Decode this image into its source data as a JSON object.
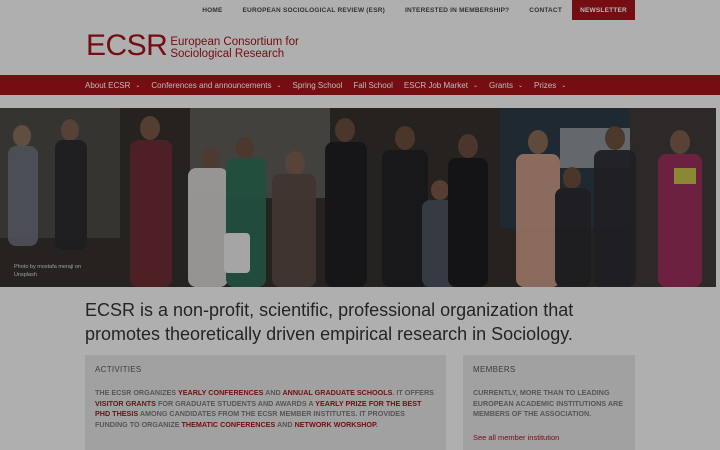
{
  "top_nav": {
    "items": [
      "HOME",
      "EUROPEAN SOCIOLOGICAL REVIEW (ESR)",
      "INTERESTED IN MEMBERSHIP?",
      "CONTACT"
    ],
    "newsletter_label": "NEWSLETTER"
  },
  "logo": {
    "abbr": "ECSR",
    "full_line1": "European Consortium for",
    "full_line2": "Sociological Research"
  },
  "main_nav": {
    "items": [
      {
        "label": "About ECSR",
        "has_dropdown": true
      },
      {
        "label": "Conferences and announcements",
        "has_dropdown": true
      },
      {
        "label": "Spring School",
        "has_dropdown": false
      },
      {
        "label": "Fall School",
        "has_dropdown": false
      },
      {
        "label": "ESCR Job Market",
        "has_dropdown": true
      },
      {
        "label": "Grants",
        "has_dropdown": true
      },
      {
        "label": "Prizes",
        "has_dropdown": true
      }
    ]
  },
  "hero": {
    "photo_credit_line1": "Photo by mostafa meraji on",
    "photo_credit_line2": "Unsplash"
  },
  "mission": {
    "text": "ECSR is a non-profit, scientific, professional organization that promotes theoretically driven empirical research in Sociology."
  },
  "activities": {
    "title": "ACTIVITIES",
    "t1": "THE ECSR ORGANIZES ",
    "h1": "YEARLY CONFERENCES",
    "t2": " AND ",
    "h2": "ANNUAL GRADUATE SCHOOLS",
    "t3": ". IT OFFERS ",
    "h3": "VISITOR GRANTS",
    "t4": " FOR GRADUATE STUDENTS AND AWARDS A ",
    "h4": "YEARLY PRIZE FOR THE BEST PHD THESIS",
    "t5": " AMONG CANDIDATES FROM THE ECSR MEMBER INSTITUTES. IT PROVIDES FUNDING TO ORGANIZE ",
    "h5": "THEMATIC CONFERENCES",
    "t6": " AND ",
    "h6": "NETWORK WORKSHOP",
    "t7": "."
  },
  "members": {
    "title": "MEMBERS",
    "text": "CURRENTLY, MORE THAN TO LEADING EUROPEAN ACADEMIC INSTITUTIONS ARE MEMBERS OF THE ASSOCIATION.",
    "link": "See all member institution"
  },
  "colors": {
    "brand_red": "#a3141b",
    "page_bg": "#f3f3f3",
    "box_bg": "#e0e0e0"
  }
}
